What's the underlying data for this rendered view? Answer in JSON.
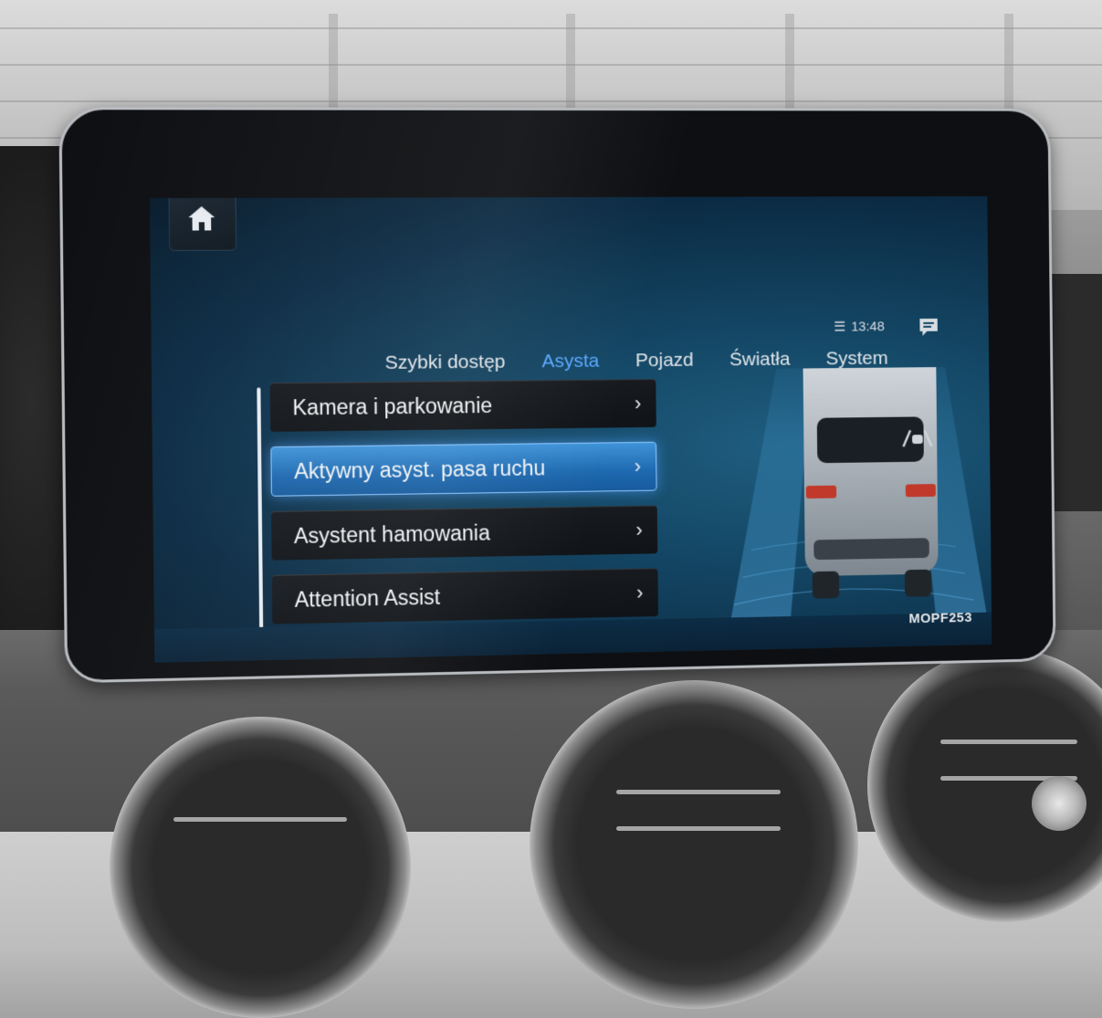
{
  "nav": {
    "home_icon": "home-icon",
    "tabs": [
      {
        "label": "Szybki dostęp",
        "active": false
      },
      {
        "label": "Asysta",
        "active": true
      },
      {
        "label": "Pojazd",
        "active": false
      },
      {
        "label": "Światła",
        "active": false
      },
      {
        "label": "System",
        "active": false
      }
    ]
  },
  "status": {
    "time": "13:48",
    "connection_icon": "phone-signal-icon",
    "messages_icon": "message-icon"
  },
  "menu": {
    "items": [
      {
        "label": "Kamera i parkowanie",
        "selected": false
      },
      {
        "label": "Aktywny asyst. pasa ruchu",
        "selected": true
      },
      {
        "label": "Asystent hamowania",
        "selected": false
      },
      {
        "label": "Attention Assist",
        "selected": false
      }
    ],
    "chevron": "›"
  },
  "illustration": {
    "lane_assist_icon": "lane-assist-icon"
  },
  "screen_code": "MOPF253",
  "colors": {
    "accent": "#5aa8ff",
    "selected_item": "#2a7fc8",
    "screen_bg": "#134563"
  }
}
